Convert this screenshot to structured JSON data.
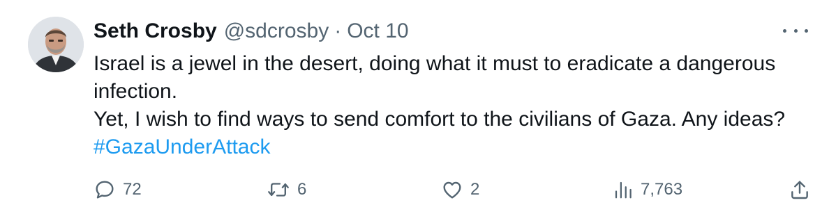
{
  "tweet": {
    "author": {
      "name": "Seth Crosby",
      "handle": "@sdcrosby",
      "separator": "·",
      "date": "Oct 10"
    },
    "text": {
      "line1": "Israel is a jewel in the desert, doing what it must to eradicate a dangerous infection.",
      "line2": "Yet, I wish to find ways to send comfort to the civilians of Gaza. Any ideas?",
      "hashtag": "#GazaUnderAttack"
    },
    "actions": {
      "replies": "72",
      "retweets": "6",
      "likes": "2",
      "views": "7,763"
    },
    "icons": {
      "reply": "reply-icon",
      "retweet": "retweet-icon",
      "like": "like-icon",
      "views": "views-icon",
      "share": "share-icon",
      "more": "more-icon"
    },
    "colors": {
      "text": "#0f1419",
      "muted": "#536471",
      "link": "#1d9bf0"
    }
  }
}
